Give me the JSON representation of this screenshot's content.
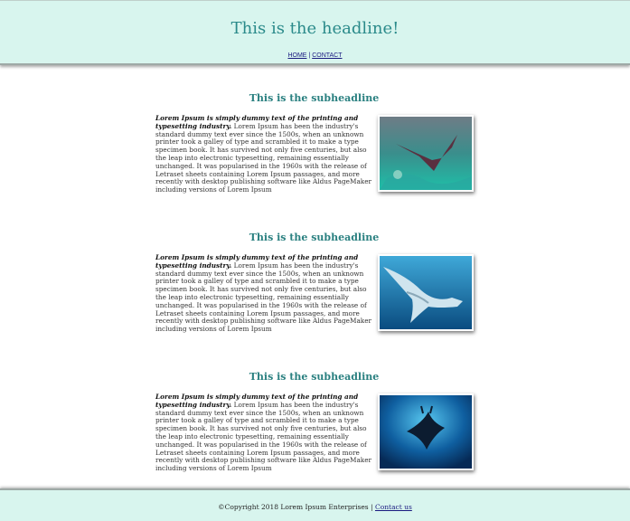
{
  "header": {
    "headline": "This is the headline!",
    "nav": {
      "home": "HOME",
      "separator": "|",
      "contact": "CONTACT"
    }
  },
  "articles": [
    {
      "subheadline": "This is the subheadline",
      "lead": "Lorem Ipsum is simply dummy text of the printing and typesetting industry.",
      "body": "Lorem Ipsum has been the industry's standard dummy text ever since the 1500s, when an unknown printer took a galley of type and scrambled it to make a type specimen book. It has survived not only five centuries, but also the leap into electronic typesetting, remaining essentially unchanged. It was popularised in the 1960s with the release of Letraset sheets containing Lorem Ipsum passages, and more recently with desktop publishing software like Aldus PageMaker including versions of Lorem Ipsum",
      "image": "manta-ray-reef-photo"
    },
    {
      "subheadline": "This is the subheadline",
      "lead": "Lorem Ipsum is simply dummy text of the printing and typesetting industry.",
      "body": "Lorem Ipsum has been the industry's standard dummy text ever since the 1500s, when an unknown printer took a galley of type and scrambled it to make a type specimen book. It has survived not only five centuries, but also the leap into electronic typesetting, remaining essentially unchanged. It was popularised in the 1960s with the release of Letraset sheets containing Lorem Ipsum passages, and more recently with desktop publishing software like Aldus PageMaker including versions of Lorem Ipsum",
      "image": "manta-ray-blue-water-photo"
    },
    {
      "subheadline": "This is the subheadline",
      "lead": "Lorem Ipsum is simply dummy text of the printing and typesetting industry.",
      "body": "Lorem Ipsum has been the industry's standard dummy text ever since the 1500s, when an unknown printer took a galley of type and scrambled it to make a type specimen book. It has survived not only five centuries, but also the leap into electronic typesetting, remaining essentially unchanged. It was popularised in the 1960s with the release of Letraset sheets containing Lorem Ipsum passages, and more recently with desktop publishing software like Aldus PageMaker including versions of Lorem Ipsum",
      "image": "manta-ray-from-below-photo"
    }
  ],
  "footer": {
    "copyright": "©Copyright 2018 Lorem Ipsum Enterprises",
    "separator": "|",
    "contact_link": "Contact us"
  },
  "colors": {
    "band_background": "#d8f5ee",
    "headline": "#2a8a8a",
    "subheadline": "#2a8080",
    "link": "#1a1a80"
  }
}
